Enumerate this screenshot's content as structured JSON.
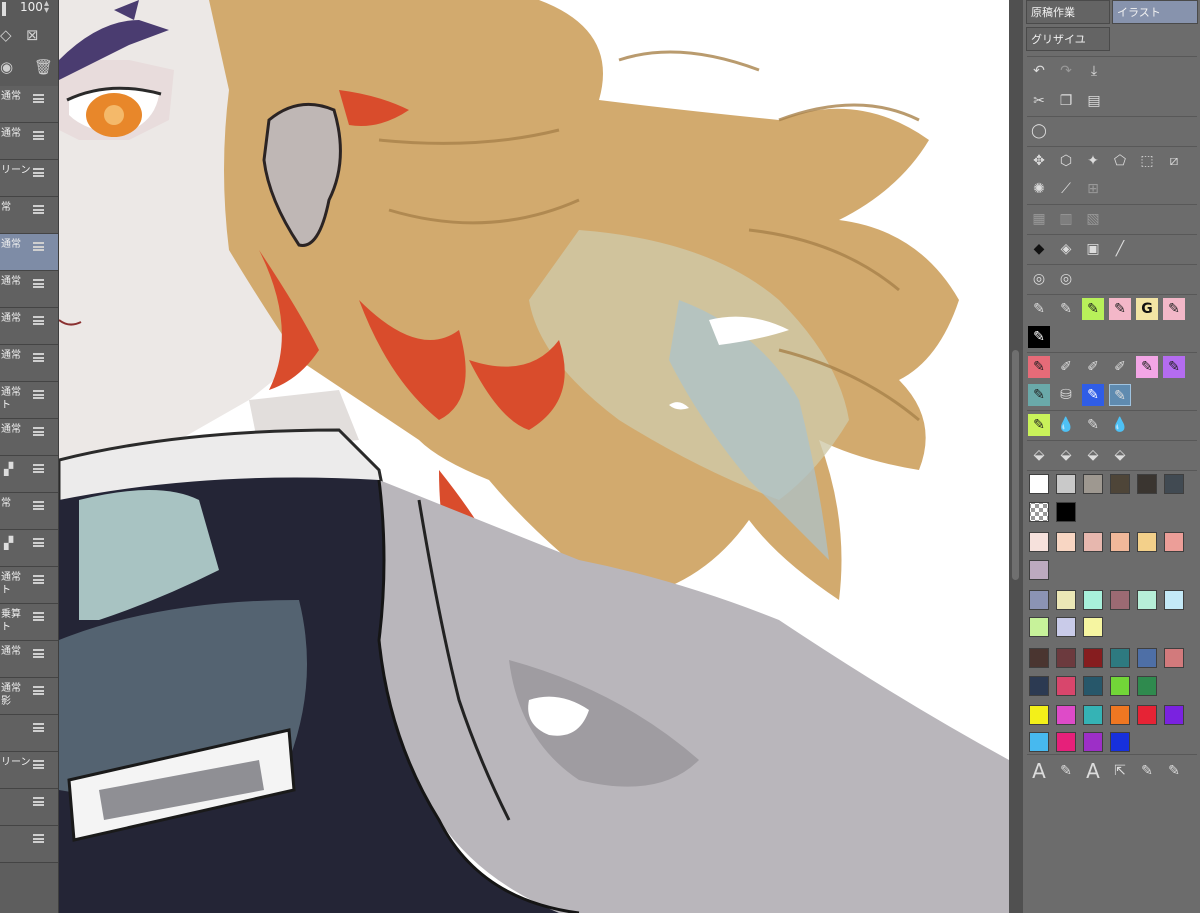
{
  "layer_panel": {
    "opacity_value": "100",
    "layers": [
      {
        "mode": "通常",
        "selected": false
      },
      {
        "mode": "通常",
        "selected": false
      },
      {
        "mode": "リーン",
        "selected": false
      },
      {
        "mode": "常",
        "selected": false
      },
      {
        "mode": "通常",
        "selected": true
      },
      {
        "mode": "通常",
        "selected": false
      },
      {
        "mode": "通常",
        "selected": false
      },
      {
        "mode": "通常",
        "selected": false
      },
      {
        "mode": "通常\nト",
        "selected": false
      },
      {
        "mode": "通常",
        "selected": false
      },
      {
        "mode": "",
        "selected": false,
        "icon": "layer-mask-icon"
      },
      {
        "mode": "常",
        "selected": false
      },
      {
        "mode": "",
        "selected": false,
        "icon": "layer-mask-icon"
      },
      {
        "mode": "通常\nト",
        "selected": false
      },
      {
        "mode": "乗算\nト",
        "selected": false
      },
      {
        "mode": "通常",
        "selected": false
      },
      {
        "mode": "通常\n影",
        "selected": false
      },
      {
        "mode": "",
        "selected": false
      },
      {
        "mode": "リーン",
        "selected": false
      },
      {
        "mode": "",
        "selected": false
      },
      {
        "mode": "",
        "selected": false
      }
    ]
  },
  "tool_panel": {
    "tabs": [
      {
        "label": "原稿作業",
        "active": false
      },
      {
        "label": "イラスト",
        "active": true
      },
      {
        "label": "グリザイユ",
        "active": false
      }
    ],
    "icons": {
      "undo": "undo-icon",
      "redo": "redo-icon",
      "save": "save-icon",
      "cut": "cut-icon",
      "copy": "copy-icon",
      "paste": "paste-icon",
      "lasso": "lasso-icon"
    },
    "text_tool_glyph": "A",
    "pen_g_glyph": "G",
    "color_rows": [
      [
        "#ffffff",
        "#c9c9c9",
        "#9e9890",
        "#4e4538",
        "#3a3530",
        "#414a52"
      ],
      [
        "checker",
        "#000000"
      ],
      [
        "#f6e1dc",
        "#f8d6c3",
        "#e7b7ae",
        "#f0b89a",
        "#f3d08a",
        "#ec9e98"
      ],
      [
        "#bdaabf"
      ],
      [
        "#8b93b4",
        "#ece7b6",
        "#a8f0db",
        "#9c6a73",
        "#b7eed8",
        "#c4e9f7"
      ],
      [
        "#c7f29a",
        "#c9cbe9",
        "#f6f5a1"
      ],
      [
        "#4a3530",
        "#6c3a3e",
        "#861d1f",
        "#2e7a80",
        "#4e6fa6",
        "#d27a7c"
      ],
      [
        "#2c3a52",
        "#d8466c",
        "#27576a",
        "#72d538",
        "#2f8a4e"
      ],
      [
        "#f3f019",
        "#de4bc8",
        "#35b3b5",
        "#ef7722",
        "#e62335",
        "#7a22e0"
      ],
      [
        "#47b9ef",
        "#e6207a",
        "#9d2fc7",
        "#1730dd"
      ]
    ]
  }
}
